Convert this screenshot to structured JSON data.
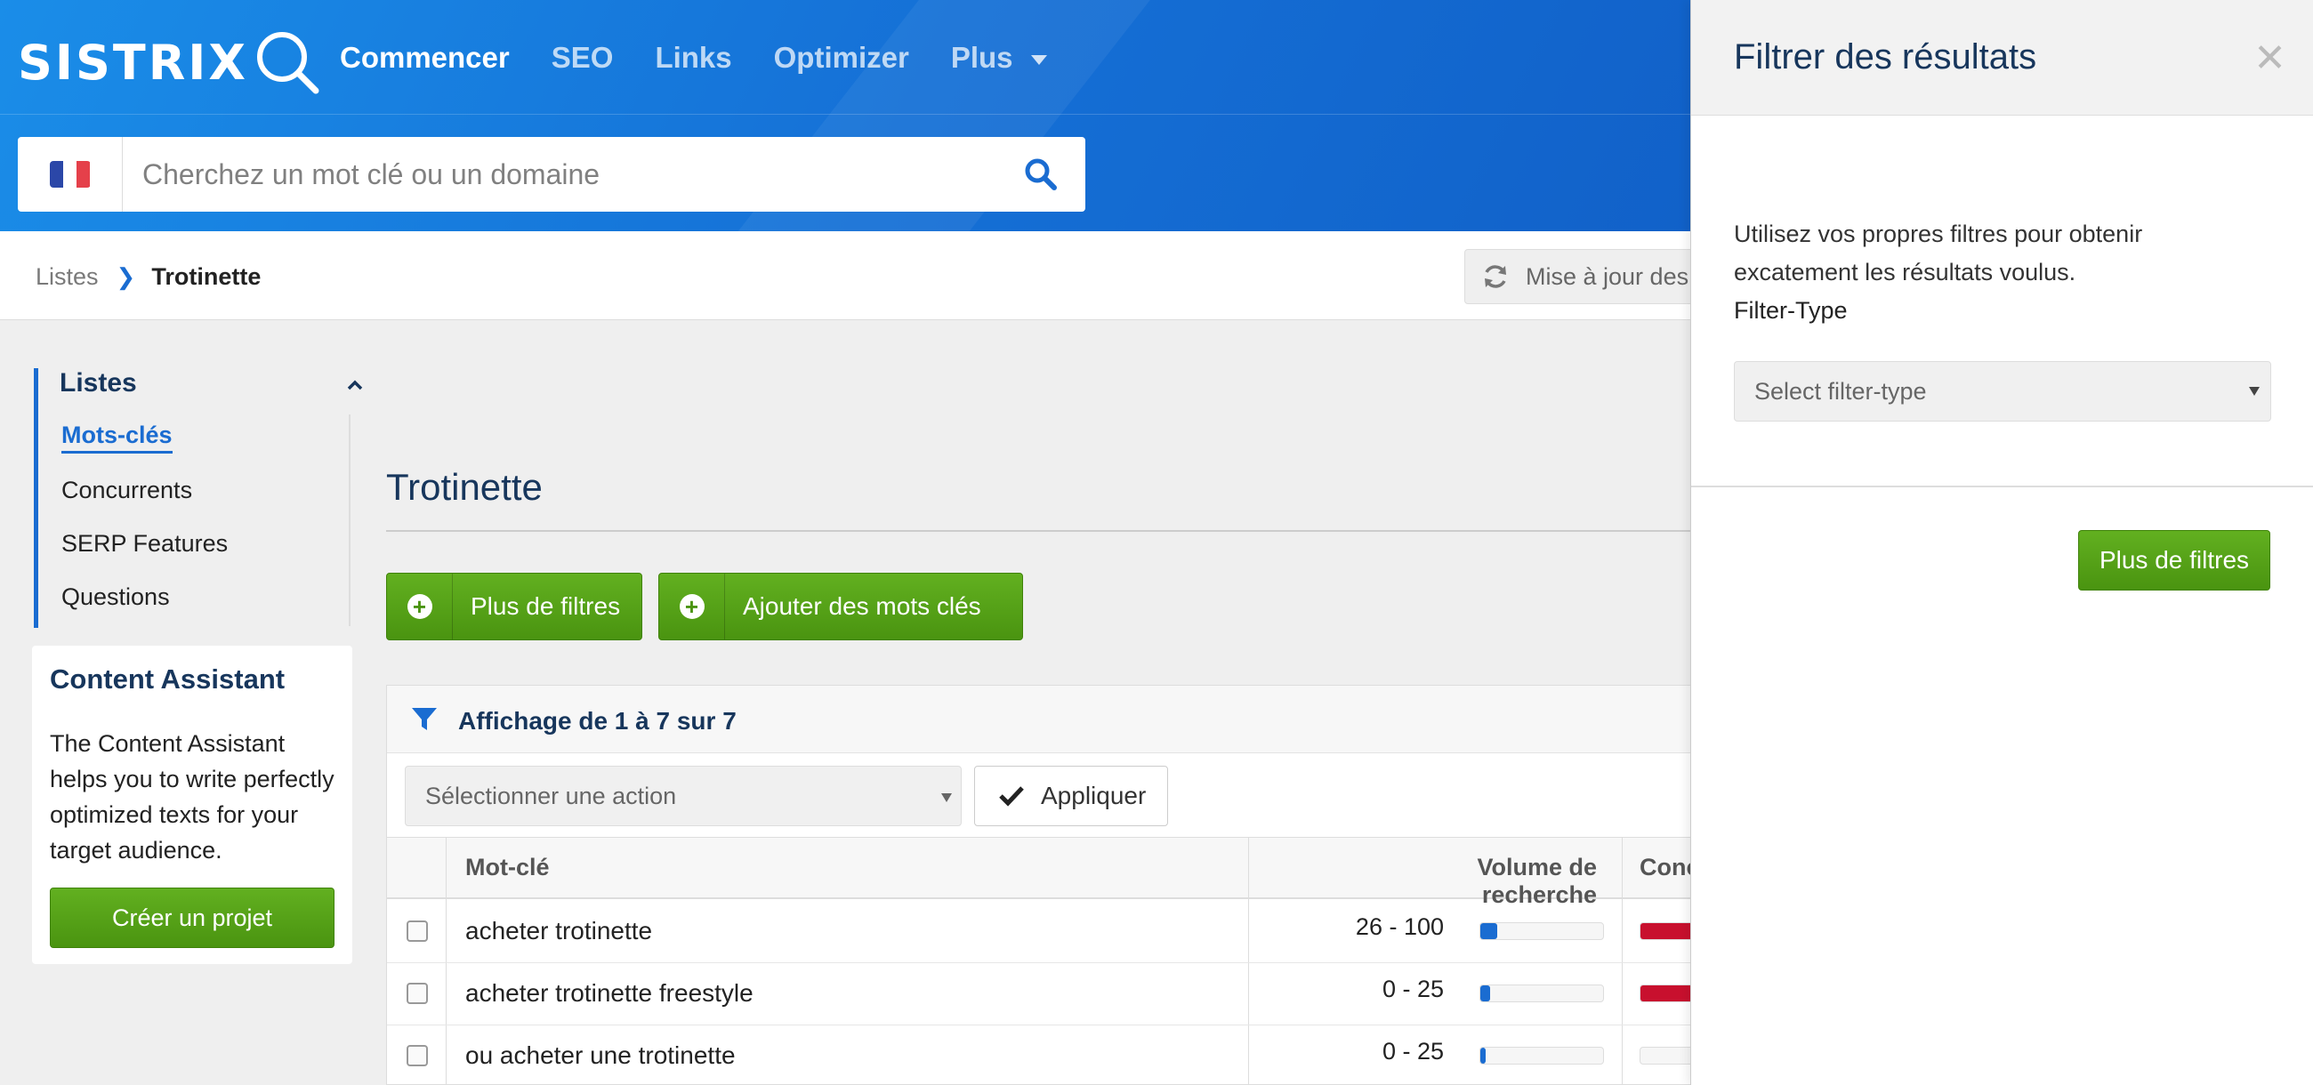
{
  "app": {
    "logo": "SISTRIX"
  },
  "nav": {
    "items": [
      {
        "label": "Commencer",
        "active": true
      },
      {
        "label": "SEO",
        "active": false
      },
      {
        "label": "Links",
        "active": false
      },
      {
        "label": "Optimizer",
        "active": false
      },
      {
        "label": "Plus",
        "active": false
      }
    ]
  },
  "search": {
    "placeholder": "Cherchez un mot clé ou un domaine",
    "value": "",
    "flag": "france-flag-icon"
  },
  "breadcrumb": {
    "parent": "Listes",
    "current": "Trotinette"
  },
  "update_button": {
    "label": "Mise à jour des"
  },
  "sidebar": {
    "title": "Listes",
    "items": [
      {
        "label": "Mots-clés",
        "active": true
      },
      {
        "label": "Concurrents",
        "active": false
      },
      {
        "label": "SERP Features",
        "active": false
      },
      {
        "label": "Questions",
        "active": false
      }
    ]
  },
  "content_assistant": {
    "title": "Content Assistant",
    "text": "The Content Assistant helps you to write perfectly optimized texts for your target audience.",
    "button": "Créer un projet"
  },
  "main": {
    "title": "Trotinette",
    "buttons": {
      "more_filters": "Plus de filtres",
      "add_keywords": "Ajouter des mots clés"
    },
    "count_text": "Affichage de 1 à 7 sur 7",
    "action_select": "Sélectionner une action",
    "apply": "Appliquer",
    "columns": {
      "keyword": "Mot-clé",
      "volume": "Volume de recherche",
      "competition": "Conc"
    },
    "rows": [
      {
        "keyword": "acheter trotinette",
        "volume": "26 - 100",
        "volume_level": 0.14,
        "competition_level": 1.0
      },
      {
        "keyword": "acheter trotinette freestyle",
        "volume": "0 - 25",
        "volume_level": 0.08,
        "competition_level": 1.0
      },
      {
        "keyword": "ou acheter une trotinette",
        "volume": "0 - 25",
        "volume_level": 0.04,
        "competition_level": 0.0
      }
    ]
  },
  "drawer": {
    "title": "Filtrer des résultats",
    "description": "Utilisez vos propres filtres pour obtenir excatement les résultats voulus.",
    "filter_type_label": "Filter-Type",
    "filter_type_placeholder": "Select filter-type",
    "button": "Plus de filtres"
  },
  "colors": {
    "brand_blue": "#1570d6",
    "accent_green": "#4a9410",
    "competition_red": "#c8102e"
  }
}
